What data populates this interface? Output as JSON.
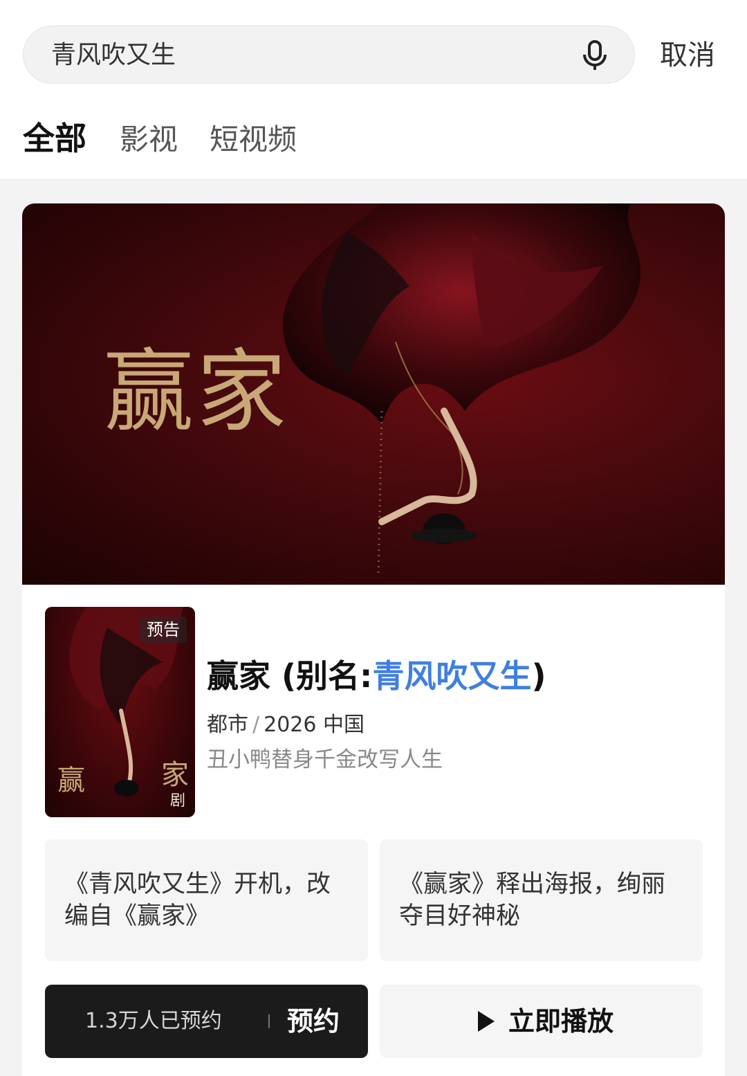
{
  "search": {
    "query": "青风吹又生",
    "cancel_label": "取消"
  },
  "tabs": [
    {
      "label": "全部",
      "active": true
    },
    {
      "label": "影视",
      "active": false
    },
    {
      "label": "短视频",
      "active": false
    }
  ],
  "result": {
    "banner_title": "赢家",
    "poster": {
      "badge": "预告",
      "left_char": "赢",
      "right_char": "家",
      "genre_char": "剧"
    },
    "title": "赢家",
    "alias_prefix": "(别名:",
    "alias": "青风吹又生",
    "alias_suffix": ")",
    "genre": "都市",
    "meta_sep": "/",
    "year_region": "2026 中国",
    "description": "丑小鸭替身千金改写人生",
    "news": [
      "《青风吹又生》开机，改编自《赢家》",
      "《赢家》释出海报，绚丽夺目好神秘"
    ],
    "reserve_count": "1.3万人已预约",
    "reserve_label": "预约",
    "play_label": "立即播放"
  },
  "colors": {
    "accent_blue": "#3f7fe0",
    "poster_red": "#4c0a0e",
    "title_gold": "#c9a877",
    "reserve_bg": "#1b1b1b"
  },
  "icons": [
    "mic-icon",
    "play-icon"
  ]
}
